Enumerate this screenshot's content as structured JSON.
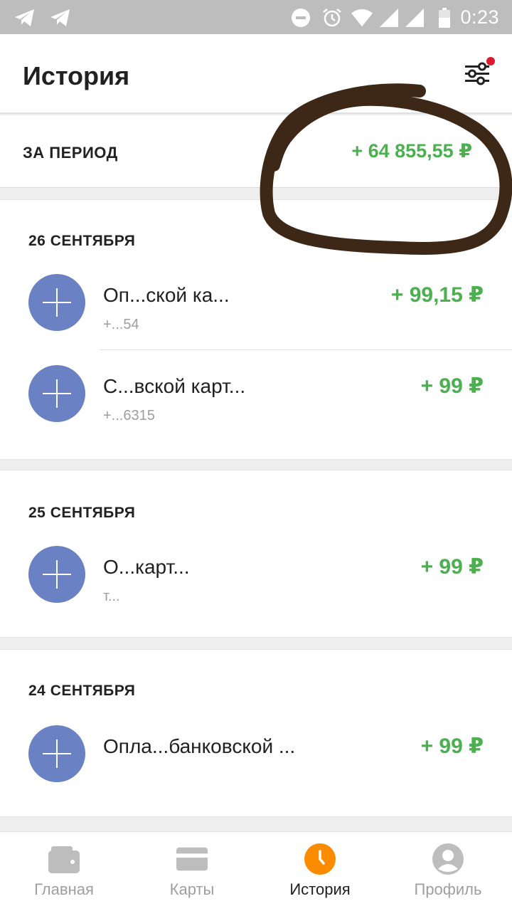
{
  "status_bar": {
    "time": "0:23",
    "icons": [
      "telegram-icon",
      "telegram-icon",
      "do-not-disturb-icon",
      "alarm-icon",
      "wifi-icon",
      "signal-icon",
      "signal-icon",
      "battery-icon"
    ]
  },
  "header": {
    "title": "История",
    "filter_icon": "sliders-icon",
    "has_notification_dot": true
  },
  "period": {
    "label": "ЗА ПЕРИОД",
    "amount": "+ 64 855,55 ₽"
  },
  "sections": [
    {
      "date": "26 СЕНТЯБРЯ",
      "transactions": [
        {
          "title": "Оп...ской ка...",
          "subtitle": "+...54",
          "amount": "+ 99,15 ₽",
          "icon": "plus-icon"
        },
        {
          "title": "С...вской карт...",
          "subtitle": "+...6315",
          "amount": "+ 99 ₽",
          "icon": "plus-icon"
        }
      ]
    },
    {
      "date": "25 СЕНТЯБРЯ",
      "transactions": [
        {
          "title": "О...карт...",
          "subtitle": "т...",
          "amount": "+ 99 ₽",
          "icon": "plus-icon"
        }
      ]
    },
    {
      "date": "24 СЕНТЯБРЯ",
      "transactions": [
        {
          "title": "Опла...банковской ...",
          "subtitle": "",
          "amount": "+ 99 ₽",
          "icon": "plus-icon"
        }
      ]
    }
  ],
  "bottom_nav": [
    {
      "label": "Главная",
      "icon": "wallet-icon",
      "active": false
    },
    {
      "label": "Карты",
      "icon": "card-icon",
      "active": false
    },
    {
      "label": "История",
      "icon": "clock-icon",
      "active": true
    },
    {
      "label": "Профиль",
      "icon": "profile-icon",
      "active": false
    }
  ],
  "colors": {
    "accent_green": "#4caf50",
    "active_orange": "#fb8c00",
    "icon_blue": "#6a82c4",
    "notification_red": "#d81b2d"
  }
}
